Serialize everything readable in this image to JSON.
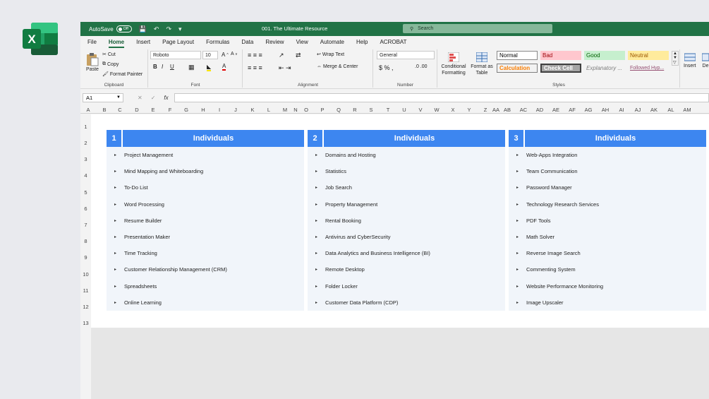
{
  "titlebar": {
    "autosave_label": "AutoSave",
    "autosave_state": "Off",
    "doc_title": "001. The Ultimate Resource",
    "search_placeholder": "Search"
  },
  "menu": [
    "File",
    "Home",
    "Insert",
    "Page Layout",
    "Formulas",
    "Data",
    "Review",
    "View",
    "Automate",
    "Help",
    "ACROBAT"
  ],
  "menu_active": "Home",
  "ribbon": {
    "clipboard": {
      "paste": "Paste",
      "cut": "Cut",
      "copy": "Copy",
      "format_painter": "Format Painter",
      "label": "Clipboard"
    },
    "font": {
      "name": "Roboto",
      "size": "10",
      "label": "Font"
    },
    "alignment": {
      "wrap": "Wrap Text",
      "merge": "Merge & Center",
      "label": "Alignment"
    },
    "number": {
      "format": "General",
      "label": "Number"
    },
    "styles": {
      "conditional": "Conditional Formatting",
      "format_table": "Format as Table",
      "chips": [
        "Normal",
        "Bad",
        "Good",
        "Neutral",
        "Calculation",
        "Check Cell",
        "Explanatory ...",
        "Followed Hyp..."
      ],
      "label": "Styles"
    },
    "cells": {
      "insert": "Insert",
      "delete": "De"
    }
  },
  "formula_bar": {
    "name_box": "A1",
    "fx": "fx"
  },
  "columns": [
    "A",
    "B",
    "C",
    "D",
    "E",
    "F",
    "G",
    "H",
    "I",
    "J",
    "K",
    "L",
    "M",
    "N",
    "O",
    "P",
    "Q",
    "R",
    "S",
    "T",
    "U",
    "V",
    "W",
    "X",
    "Y",
    "Z",
    "AA",
    "AB",
    "AC",
    "AD",
    "AE",
    "AF",
    "AG",
    "AH",
    "AI",
    "AJ",
    "AK",
    "AL",
    "AM"
  ],
  "rows": [
    "1",
    "2",
    "3",
    "4",
    "5",
    "6",
    "7",
    "8",
    "9",
    "10",
    "11",
    "12",
    "13"
  ],
  "panels": [
    {
      "number": "1",
      "title": "Individuals",
      "items": [
        "Project Management",
        "Mind Mapping and Whiteboarding",
        "To-Do List",
        "Word Processing",
        "Resume Builder",
        "Presentation Maker",
        "Time Tracking",
        "Customer Relationship Management (CRM)",
        "Spreadsheets",
        "Online Learning"
      ]
    },
    {
      "number": "2",
      "title": "Individuals",
      "items": [
        "Domains and Hosting",
        "Statistics",
        "Job Search",
        "Property Management",
        "Rental Booking",
        "Antivirus and CyberSecurity",
        "Data Analytics and Business Intelligence (BI)",
        "Remote Desktop",
        "Folder Locker",
        "Customer Data Platform (CDP)"
      ]
    },
    {
      "number": "3",
      "title": "Individuals",
      "items": [
        "Web-Apps Integration",
        "Team Communication",
        "Password Manager",
        "Technology Research Services",
        "PDF Tools",
        "Math Solver",
        "Reverse Image Search",
        "Commenting System",
        "Website Performance Monitoring",
        "Image Upscaler"
      ]
    }
  ],
  "colors": {
    "excel_green": "#217346",
    "header_blue": "#3d86f0",
    "panel_bg": "#f1f5fa"
  }
}
